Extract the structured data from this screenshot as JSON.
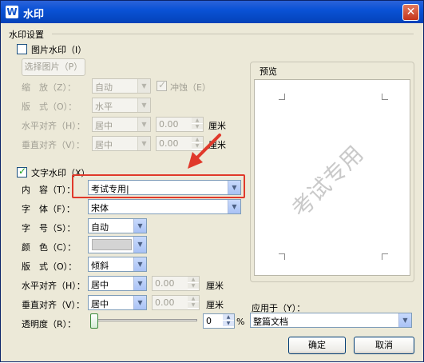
{
  "window": {
    "title": "水印",
    "close_glyph": "✕"
  },
  "settings_title": "水印设置",
  "picture": {
    "checkbox_label": "图片水印（I）",
    "select_button": "选择图片（P）",
    "scale_label": "缩　放（Z）：",
    "scale_value": "自动",
    "washout_label": "冲蚀（E）",
    "layout_label": "版　式（O）：",
    "layout_value": "水平",
    "h_align_label": "水平对齐（H）：",
    "h_align_value": "居中",
    "h_offset": "0.00",
    "h_unit": "厘米",
    "v_align_label": "垂直对齐（V）：",
    "v_align_value": "居中",
    "v_offset": "0.00",
    "v_unit": "厘米"
  },
  "text": {
    "checkbox_label": "文字水印（X）",
    "content_label": "内　容（T）：",
    "content_value": "考试专用|",
    "font_label": "字　体（F）：",
    "font_value": "宋体",
    "size_label": "字　号（S）：",
    "size_value": "自动",
    "color_label": "颜　色（C）：",
    "layout_label": "版　式（O）：",
    "layout_value": "倾斜",
    "h_align_label": "水平对齐（H）：",
    "h_align_value": "居中",
    "h_offset": "0.00",
    "h_unit": "厘米",
    "v_align_label": "垂直对齐（V）：",
    "v_align_value": "居中",
    "v_offset": "0.00",
    "v_unit": "厘米",
    "transparency_label": "透明度（R）：",
    "transparency_value": "0",
    "transparency_unit": "%"
  },
  "preview": {
    "label": "预览",
    "watermark": "考试专用"
  },
  "apply_to": {
    "label": "应用于（Y）：",
    "value": "整篇文档"
  },
  "buttons": {
    "ok": "确定",
    "cancel": "取消"
  },
  "colors": {
    "highlight": "#e0392b",
    "title_bar": "#0a52d6"
  }
}
